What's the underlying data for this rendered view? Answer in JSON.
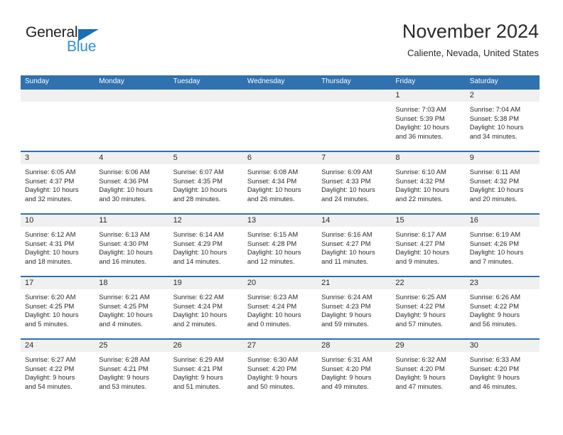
{
  "logo": {
    "text_primary": "General",
    "text_secondary": "Blue",
    "primary_color": "#231f20",
    "secondary_color": "#2e8fd4",
    "triangle_color": "#1a6fb5"
  },
  "header": {
    "title": "November 2024",
    "subtitle": "Caliente, Nevada, United States"
  },
  "theme": {
    "header_blue": "#3071b0",
    "day_band_gray": "#f0f0f0",
    "text_color": "#2b2b2b"
  },
  "calendar": {
    "weekday_headers": [
      "Sunday",
      "Monday",
      "Tuesday",
      "Wednesday",
      "Thursday",
      "Friday",
      "Saturday"
    ],
    "weeks": [
      [
        {
          "day": "",
          "sunrise": "",
          "sunset": "",
          "daylight_line1": "",
          "daylight_line2": ""
        },
        {
          "day": "",
          "sunrise": "",
          "sunset": "",
          "daylight_line1": "",
          "daylight_line2": ""
        },
        {
          "day": "",
          "sunrise": "",
          "sunset": "",
          "daylight_line1": "",
          "daylight_line2": ""
        },
        {
          "day": "",
          "sunrise": "",
          "sunset": "",
          "daylight_line1": "",
          "daylight_line2": ""
        },
        {
          "day": "",
          "sunrise": "",
          "sunset": "",
          "daylight_line1": "",
          "daylight_line2": ""
        },
        {
          "day": "1",
          "sunrise": "Sunrise: 7:03 AM",
          "sunset": "Sunset: 5:39 PM",
          "daylight_line1": "Daylight: 10 hours",
          "daylight_line2": "and 36 minutes."
        },
        {
          "day": "2",
          "sunrise": "Sunrise: 7:04 AM",
          "sunset": "Sunset: 5:38 PM",
          "daylight_line1": "Daylight: 10 hours",
          "daylight_line2": "and 34 minutes."
        }
      ],
      [
        {
          "day": "3",
          "sunrise": "Sunrise: 6:05 AM",
          "sunset": "Sunset: 4:37 PM",
          "daylight_line1": "Daylight: 10 hours",
          "daylight_line2": "and 32 minutes."
        },
        {
          "day": "4",
          "sunrise": "Sunrise: 6:06 AM",
          "sunset": "Sunset: 4:36 PM",
          "daylight_line1": "Daylight: 10 hours",
          "daylight_line2": "and 30 minutes."
        },
        {
          "day": "5",
          "sunrise": "Sunrise: 6:07 AM",
          "sunset": "Sunset: 4:35 PM",
          "daylight_line1": "Daylight: 10 hours",
          "daylight_line2": "and 28 minutes."
        },
        {
          "day": "6",
          "sunrise": "Sunrise: 6:08 AM",
          "sunset": "Sunset: 4:34 PM",
          "daylight_line1": "Daylight: 10 hours",
          "daylight_line2": "and 26 minutes."
        },
        {
          "day": "7",
          "sunrise": "Sunrise: 6:09 AM",
          "sunset": "Sunset: 4:33 PM",
          "daylight_line1": "Daylight: 10 hours",
          "daylight_line2": "and 24 minutes."
        },
        {
          "day": "8",
          "sunrise": "Sunrise: 6:10 AM",
          "sunset": "Sunset: 4:32 PM",
          "daylight_line1": "Daylight: 10 hours",
          "daylight_line2": "and 22 minutes."
        },
        {
          "day": "9",
          "sunrise": "Sunrise: 6:11 AM",
          "sunset": "Sunset: 4:32 PM",
          "daylight_line1": "Daylight: 10 hours",
          "daylight_line2": "and 20 minutes."
        }
      ],
      [
        {
          "day": "10",
          "sunrise": "Sunrise: 6:12 AM",
          "sunset": "Sunset: 4:31 PM",
          "daylight_line1": "Daylight: 10 hours",
          "daylight_line2": "and 18 minutes."
        },
        {
          "day": "11",
          "sunrise": "Sunrise: 6:13 AM",
          "sunset": "Sunset: 4:30 PM",
          "daylight_line1": "Daylight: 10 hours",
          "daylight_line2": "and 16 minutes."
        },
        {
          "day": "12",
          "sunrise": "Sunrise: 6:14 AM",
          "sunset": "Sunset: 4:29 PM",
          "daylight_line1": "Daylight: 10 hours",
          "daylight_line2": "and 14 minutes."
        },
        {
          "day": "13",
          "sunrise": "Sunrise: 6:15 AM",
          "sunset": "Sunset: 4:28 PM",
          "daylight_line1": "Daylight: 10 hours",
          "daylight_line2": "and 12 minutes."
        },
        {
          "day": "14",
          "sunrise": "Sunrise: 6:16 AM",
          "sunset": "Sunset: 4:27 PM",
          "daylight_line1": "Daylight: 10 hours",
          "daylight_line2": "and 11 minutes."
        },
        {
          "day": "15",
          "sunrise": "Sunrise: 6:17 AM",
          "sunset": "Sunset: 4:27 PM",
          "daylight_line1": "Daylight: 10 hours",
          "daylight_line2": "and 9 minutes."
        },
        {
          "day": "16",
          "sunrise": "Sunrise: 6:19 AM",
          "sunset": "Sunset: 4:26 PM",
          "daylight_line1": "Daylight: 10 hours",
          "daylight_line2": "and 7 minutes."
        }
      ],
      [
        {
          "day": "17",
          "sunrise": "Sunrise: 6:20 AM",
          "sunset": "Sunset: 4:25 PM",
          "daylight_line1": "Daylight: 10 hours",
          "daylight_line2": "and 5 minutes."
        },
        {
          "day": "18",
          "sunrise": "Sunrise: 6:21 AM",
          "sunset": "Sunset: 4:25 PM",
          "daylight_line1": "Daylight: 10 hours",
          "daylight_line2": "and 4 minutes."
        },
        {
          "day": "19",
          "sunrise": "Sunrise: 6:22 AM",
          "sunset": "Sunset: 4:24 PM",
          "daylight_line1": "Daylight: 10 hours",
          "daylight_line2": "and 2 minutes."
        },
        {
          "day": "20",
          "sunrise": "Sunrise: 6:23 AM",
          "sunset": "Sunset: 4:24 PM",
          "daylight_line1": "Daylight: 10 hours",
          "daylight_line2": "and 0 minutes."
        },
        {
          "day": "21",
          "sunrise": "Sunrise: 6:24 AM",
          "sunset": "Sunset: 4:23 PM",
          "daylight_line1": "Daylight: 9 hours",
          "daylight_line2": "and 59 minutes."
        },
        {
          "day": "22",
          "sunrise": "Sunrise: 6:25 AM",
          "sunset": "Sunset: 4:22 PM",
          "daylight_line1": "Daylight: 9 hours",
          "daylight_line2": "and 57 minutes."
        },
        {
          "day": "23",
          "sunrise": "Sunrise: 6:26 AM",
          "sunset": "Sunset: 4:22 PM",
          "daylight_line1": "Daylight: 9 hours",
          "daylight_line2": "and 56 minutes."
        }
      ],
      [
        {
          "day": "24",
          "sunrise": "Sunrise: 6:27 AM",
          "sunset": "Sunset: 4:22 PM",
          "daylight_line1": "Daylight: 9 hours",
          "daylight_line2": "and 54 minutes."
        },
        {
          "day": "25",
          "sunrise": "Sunrise: 6:28 AM",
          "sunset": "Sunset: 4:21 PM",
          "daylight_line1": "Daylight: 9 hours",
          "daylight_line2": "and 53 minutes."
        },
        {
          "day": "26",
          "sunrise": "Sunrise: 6:29 AM",
          "sunset": "Sunset: 4:21 PM",
          "daylight_line1": "Daylight: 9 hours",
          "daylight_line2": "and 51 minutes."
        },
        {
          "day": "27",
          "sunrise": "Sunrise: 6:30 AM",
          "sunset": "Sunset: 4:20 PM",
          "daylight_line1": "Daylight: 9 hours",
          "daylight_line2": "and 50 minutes."
        },
        {
          "day": "28",
          "sunrise": "Sunrise: 6:31 AM",
          "sunset": "Sunset: 4:20 PM",
          "daylight_line1": "Daylight: 9 hours",
          "daylight_line2": "and 49 minutes."
        },
        {
          "day": "29",
          "sunrise": "Sunrise: 6:32 AM",
          "sunset": "Sunset: 4:20 PM",
          "daylight_line1": "Daylight: 9 hours",
          "daylight_line2": "and 47 minutes."
        },
        {
          "day": "30",
          "sunrise": "Sunrise: 6:33 AM",
          "sunset": "Sunset: 4:20 PM",
          "daylight_line1": "Daylight: 9 hours",
          "daylight_line2": "and 46 minutes."
        }
      ]
    ]
  }
}
